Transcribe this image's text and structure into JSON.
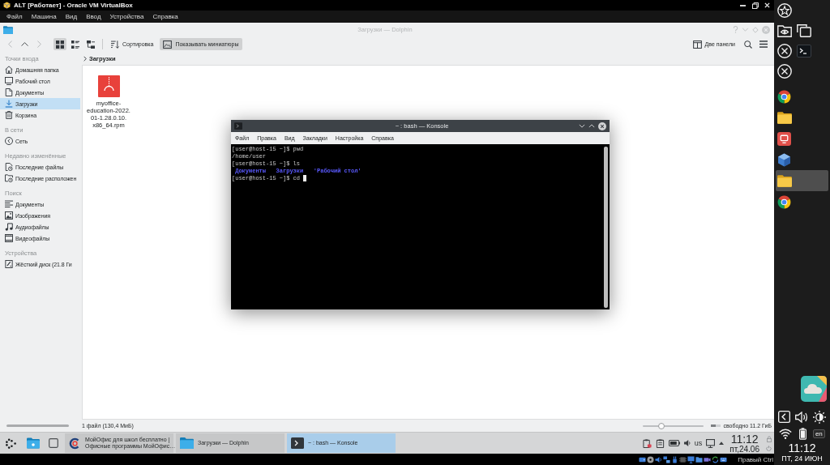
{
  "vbox": {
    "title": "ALT [Работает] - Oracle VM VirtualBox",
    "menu": [
      "Файл",
      "Машина",
      "Вид",
      "Ввод",
      "Устройства",
      "Справка"
    ],
    "host_key": "Правый Ctrl"
  },
  "dolphin": {
    "title": "Загрузки — Dolphin",
    "nav": [
      {
        "kind": "back",
        "disabled": true
      },
      {
        "kind": "up",
        "disabled": false
      },
      {
        "kind": "forward",
        "disabled": true
      }
    ],
    "view_modes": [
      {
        "kind": "icons",
        "selected": true
      },
      {
        "kind": "compact",
        "selected": false
      },
      {
        "kind": "details",
        "selected": false
      }
    ],
    "sort_button": "Сортировка",
    "preview_button": {
      "label": "Показывать миниатюры",
      "checked": true
    },
    "split_button": "Две панели",
    "places": [
      {
        "heading": "Точки входа",
        "items": [
          {
            "kind": "home",
            "label": "Домашняя папка",
            "selected": false
          },
          {
            "kind": "desktop",
            "label": "Рабочий стол",
            "selected": false
          },
          {
            "kind": "documents",
            "label": "Документы",
            "selected": false
          },
          {
            "kind": "downloads",
            "label": "Загрузки",
            "selected": true
          },
          {
            "kind": "trash",
            "label": "Корзина",
            "selected": false
          }
        ]
      },
      {
        "heading": "В сети",
        "items": [
          {
            "kind": "network",
            "label": "Сеть",
            "selected": false
          }
        ]
      },
      {
        "heading": "Недавно изменённые",
        "items": [
          {
            "kind": "recent",
            "label": "Последние файлы",
            "selected": false
          },
          {
            "kind": "places",
            "label": "Последние расположен",
            "selected": false
          }
        ]
      },
      {
        "heading": "Поиск",
        "items": [
          {
            "kind": "text",
            "label": "Документы",
            "selected": false
          },
          {
            "kind": "images",
            "label": "Изображения",
            "selected": false
          },
          {
            "kind": "audio",
            "label": "Аудиофайлы",
            "selected": false
          },
          {
            "kind": "video",
            "label": "Видеофайлы",
            "selected": false
          }
        ]
      },
      {
        "heading": "Устройства",
        "items": [
          {
            "kind": "drive",
            "label": "Жёсткий диск (21.8 Ги",
            "selected": false
          }
        ]
      }
    ],
    "breadcrumb": "Загрузки",
    "files": [
      {
        "kind": "package",
        "name_lines": [
          "myoffice-",
          "education-2022.",
          "01-1.28.0.10.",
          "x86_64.rpm"
        ]
      }
    ],
    "status": {
      "summary": "1 файл (130,4 МиБ)",
      "zoom": {
        "level": 0.27
      },
      "free_space": {
        "label": "свободно 11.2 ГиБ",
        "level": 0.49
      }
    }
  },
  "konsole": {
    "title": "~ : bash — Konsole",
    "menu": [
      "Файл",
      "Правка",
      "Вид",
      "Закладки",
      "Настройка",
      "Справка"
    ],
    "lines": [
      {
        "kind": "text",
        "text": "[user@host-15 ~]$ pwd",
        "cursor": false
      },
      {
        "kind": "text",
        "text": "/home/user",
        "cursor": false
      },
      {
        "kind": "text",
        "text": "[user@host-15 ~]$ ls",
        "cursor": false
      },
      {
        "kind": "listing",
        "items": [
          "Документы",
          "Загрузки",
          "'Рабочий стол'"
        ],
        "cursor": false
      },
      {
        "kind": "text",
        "text": "[user@host-15 ~]$ cd",
        "cursor": true
      }
    ]
  },
  "taskbar": {
    "tasks": [
      {
        "kind": "office",
        "lines": [
          "МойОфис для школ бесплатно |",
          "Офисные программы МойОфис…"
        ],
        "selected": false
      },
      {
        "kind": "folder",
        "lines": [
          "Загрузки — Dolphin"
        ],
        "selected": false
      },
      {
        "kind": "terminal",
        "lines": [
          "~ : bash — Konsole"
        ],
        "selected": true
      }
    ],
    "layout": "us",
    "time": "11:12",
    "date": "пт,24.06"
  },
  "dock": {
    "apps": [
      {
        "kind": "browser",
        "selected": false
      },
      {
        "kind": "folder",
        "selected": false
      },
      {
        "kind": "launcher",
        "selected": false
      },
      {
        "kind": "package",
        "selected": false
      },
      {
        "kind": "folder",
        "selected": true
      },
      {
        "kind": "browser",
        "selected": false
      }
    ],
    "keyboard": "en",
    "time": "11:12",
    "date": "ПТ, 24 ИЮН"
  }
}
